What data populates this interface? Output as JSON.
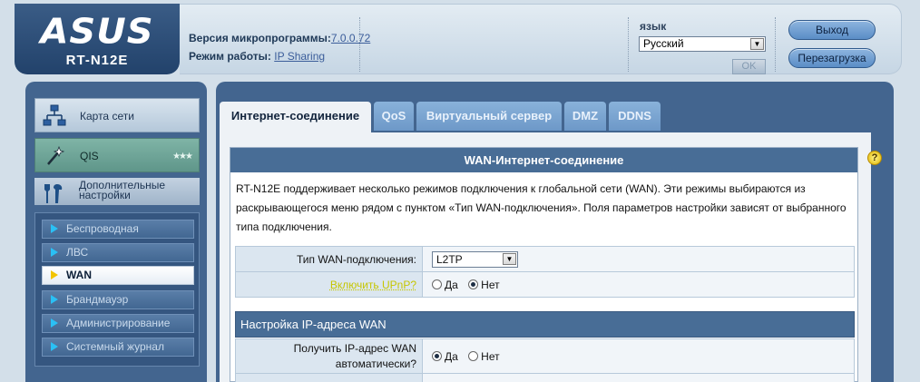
{
  "header": {
    "brand": "ASUS",
    "model": "RT-N12E",
    "firmware_label": "Версия микропрограммы:",
    "firmware_value": "7.0.0.72",
    "mode_label": "Режим работы:",
    "mode_value": "IP Sharing",
    "language_label": "язык",
    "language_value": "Русский",
    "ok_label": "OK",
    "logout_label": "Выход",
    "reboot_label": "Перезагрузка"
  },
  "sidebar": {
    "tiles": [
      {
        "label": "Карта сети",
        "icon": "network-map-icon"
      },
      {
        "label": "QIS",
        "icon": "magic-wand-icon"
      },
      {
        "label": "Дополнительные настройки",
        "icon": "tools-icon"
      }
    ],
    "qis_stars": "★★★",
    "submenu": [
      {
        "label": "Беспроводная",
        "active": false
      },
      {
        "label": "ЛВС",
        "active": false
      },
      {
        "label": "WAN",
        "active": true
      },
      {
        "label": "Брандмауэр",
        "active": false
      },
      {
        "label": "Администрирование",
        "active": false
      },
      {
        "label": "Системный журнал",
        "active": false
      }
    ]
  },
  "main": {
    "tabs": [
      {
        "label": "Интернет-соединение",
        "active": true
      },
      {
        "label": "QoS",
        "active": false
      },
      {
        "label": "Виртуальный сервер",
        "active": false
      },
      {
        "label": "DMZ",
        "active": false
      },
      {
        "label": "DDNS",
        "active": false
      }
    ],
    "help_icon": "?",
    "card_title": "WAN-Интернет-соединение",
    "description": "RT-N12E поддерживает несколько режимов подключения к глобальной сети (WAN). Эти режимы выбираются из раскрывающегося меню рядом с пунктом «Тип WAN-подключения». Поля параметров настройки зависят от выбранного типа подключения.",
    "wan_type_label": "Тип WAN-подключения:",
    "wan_type_value": "L2TP",
    "upnp_label": "Включить UPnP?",
    "option_yes": "Да",
    "option_no": "Нет",
    "upnp_value": "no",
    "section2_title": "Настройка IP-адреса WAN",
    "auto_ip_label": "Получить IP-адрес WAN автоматически?",
    "auto_ip_value": "yes"
  },
  "colors": {
    "frame_blue": "#43658f",
    "header_bar": "#486d96",
    "tab_blue": "#7aa3d1",
    "active_indicator": "#f2c400"
  }
}
